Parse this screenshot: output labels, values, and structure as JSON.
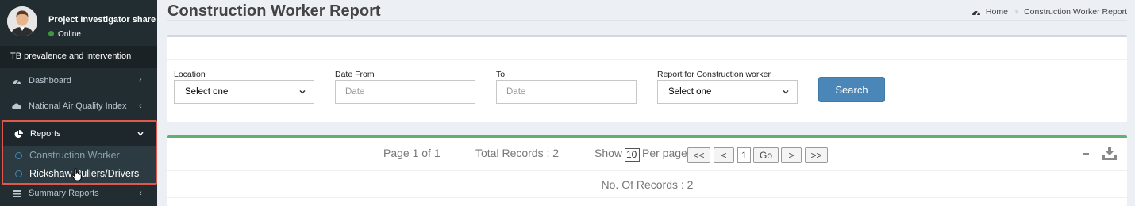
{
  "user": {
    "name": "Project Investigator share In",
    "status": "Online"
  },
  "sidebar": {
    "header": "TB prevalence and intervention",
    "items": [
      {
        "label": "Dashboard",
        "icon": "dashboard-icon"
      },
      {
        "label": "National Air Quality Index",
        "icon": "cloud-icon"
      },
      {
        "label": "Reports",
        "icon": "pie-chart-icon"
      },
      {
        "label": "Summary Reports",
        "icon": "list-icon"
      }
    ],
    "reports_submenu": [
      {
        "label": "Construction Worker"
      },
      {
        "label": "Rickshaw Pullers/Drivers"
      }
    ]
  },
  "page": {
    "title": "Construction Worker Report"
  },
  "breadcrumb": {
    "home": "Home",
    "current": "Construction Worker Report"
  },
  "filters": {
    "location_label": "Location",
    "location_value": "Select one",
    "date_from_label": "Date From",
    "date_from_placeholder": "Date",
    "to_label": "To",
    "to_placeholder": "Date",
    "report_label": "Report for Construction worker",
    "report_value": "Select one",
    "search_label": "Search"
  },
  "results": {
    "page_info": "Page 1 of 1",
    "total_records": "Total Records : 2",
    "show_label": "Show",
    "per_page_value": "10",
    "per_page_label": "Per page",
    "first_label": "<<",
    "prev_label": "<",
    "current_page": "1",
    "go_label": "Go",
    "next_label": ">",
    "last_label": ">>",
    "no_of_records": "No. Of Records : 2"
  },
  "colors": {
    "sidebar_bg": "#222d32",
    "accent_blue": "#3c8dbc",
    "search_button": "#4a86b8",
    "results_border": "#5fb16f",
    "highlight_border": "#e0574c"
  }
}
